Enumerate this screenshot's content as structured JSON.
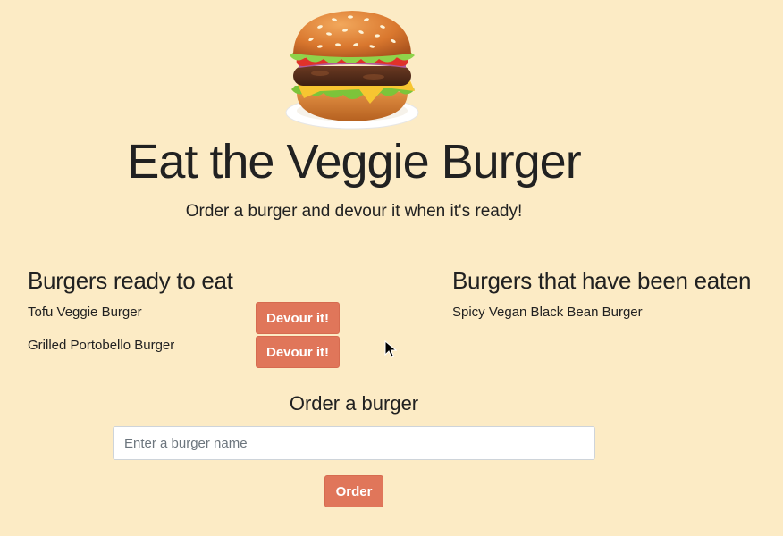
{
  "header": {
    "title": "Eat the Veggie Burger",
    "tagline": "Order a burger and devour it when it's ready!"
  },
  "ready_section": {
    "heading": "Burgers ready to eat",
    "items": [
      {
        "name": "Tofu Veggie Burger",
        "button_label": "Devour it!"
      },
      {
        "name": "Grilled Portobello Burger",
        "button_label": "Devour it!"
      }
    ]
  },
  "eaten_section": {
    "heading": "Burgers that have been eaten",
    "items": [
      {
        "name": "Spicy Vegan Black Bean Burger"
      }
    ]
  },
  "order_form": {
    "heading": "Order a burger",
    "input_placeholder": "Enter a burger name",
    "input_value": "",
    "submit_label": "Order"
  },
  "colors": {
    "background": "#fcebc5",
    "button": "#e0765a",
    "text": "#212121"
  },
  "icons": {
    "logo": "burger-image",
    "pointer": "mouse-cursor-icon"
  }
}
